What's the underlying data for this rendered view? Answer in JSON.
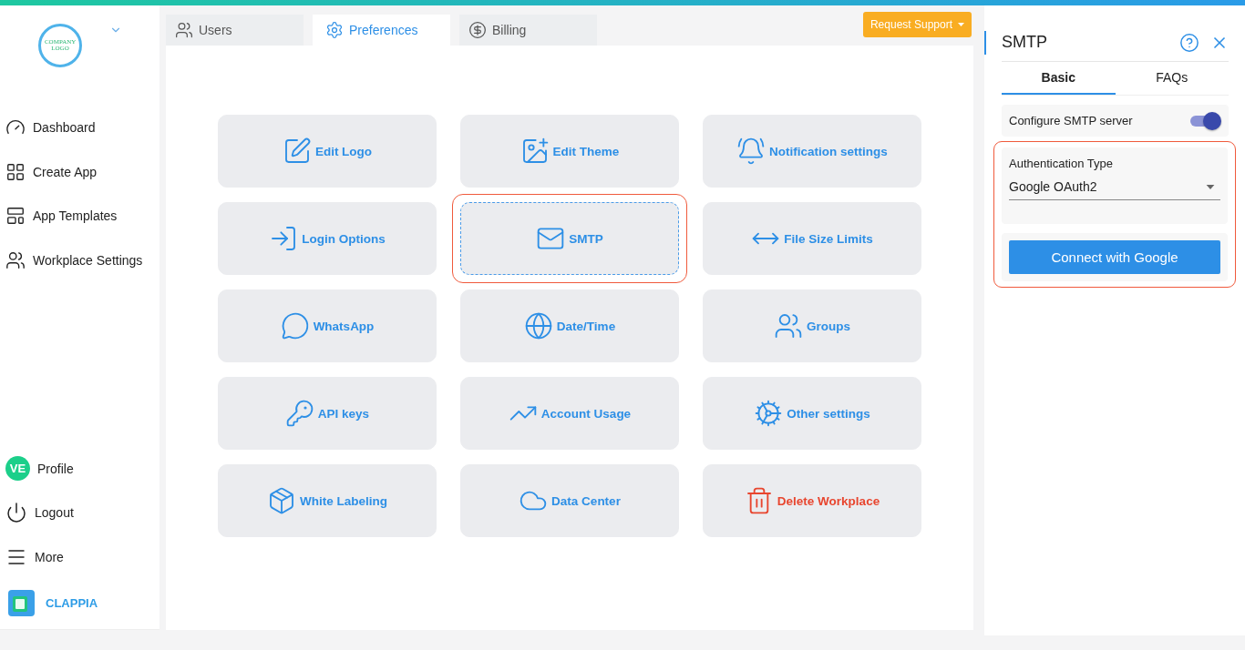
{
  "sidebar": {
    "logo_text": "COMPANY LOGO",
    "nav": [
      {
        "label": "Dashboard"
      },
      {
        "label": "Create App"
      },
      {
        "label": "App Templates"
      },
      {
        "label": "Workplace Settings"
      }
    ],
    "profile": {
      "initials": "VE",
      "label": "Profile"
    },
    "bottom": [
      {
        "label": "Logout"
      },
      {
        "label": "More"
      }
    ],
    "brand": "CLAPPIA"
  },
  "tabs": [
    {
      "label": "Users",
      "selected": false
    },
    {
      "label": "Preferences",
      "selected": true
    },
    {
      "label": "Billing",
      "selected": false
    }
  ],
  "request_button": "Request Support",
  "tiles": [
    {
      "label": "Edit Logo",
      "selected": false,
      "highlighted": false,
      "kind": "normal"
    },
    {
      "label": "Edit Theme",
      "selected": false,
      "highlighted": false,
      "kind": "normal"
    },
    {
      "label": "Notification settings",
      "selected": false,
      "highlighted": false,
      "kind": "normal"
    },
    {
      "label": "Login Options",
      "selected": false,
      "highlighted": false,
      "kind": "normal"
    },
    {
      "label": "SMTP",
      "selected": true,
      "highlighted": true,
      "kind": "normal"
    },
    {
      "label": "File Size Limits",
      "selected": false,
      "highlighted": false,
      "kind": "normal"
    },
    {
      "label": "WhatsApp",
      "selected": false,
      "highlighted": false,
      "kind": "normal"
    },
    {
      "label": "Date/Time",
      "selected": false,
      "highlighted": false,
      "kind": "normal"
    },
    {
      "label": "Groups",
      "selected": false,
      "highlighted": false,
      "kind": "normal"
    },
    {
      "label": "API keys",
      "selected": false,
      "highlighted": false,
      "kind": "normal"
    },
    {
      "label": "Account Usage",
      "selected": false,
      "highlighted": false,
      "kind": "normal"
    },
    {
      "label": "Other settings",
      "selected": false,
      "highlighted": false,
      "kind": "normal"
    },
    {
      "label": "White Labeling",
      "selected": false,
      "highlighted": false,
      "kind": "normal"
    },
    {
      "label": "Data Center",
      "selected": false,
      "highlighted": false,
      "kind": "normal"
    },
    {
      "label": "Delete Workplace",
      "selected": false,
      "highlighted": false,
      "kind": "danger"
    }
  ],
  "panel": {
    "title": "SMTP",
    "tabs": [
      {
        "label": "Basic",
        "selected": true
      },
      {
        "label": "FAQs",
        "selected": false
      }
    ],
    "toggle": {
      "label": "Configure SMTP server",
      "on": true
    },
    "auth": {
      "highlighted": true,
      "label": "Authentication Type",
      "value": "Google OAuth2"
    },
    "connect_button": "Connect with Google"
  }
}
